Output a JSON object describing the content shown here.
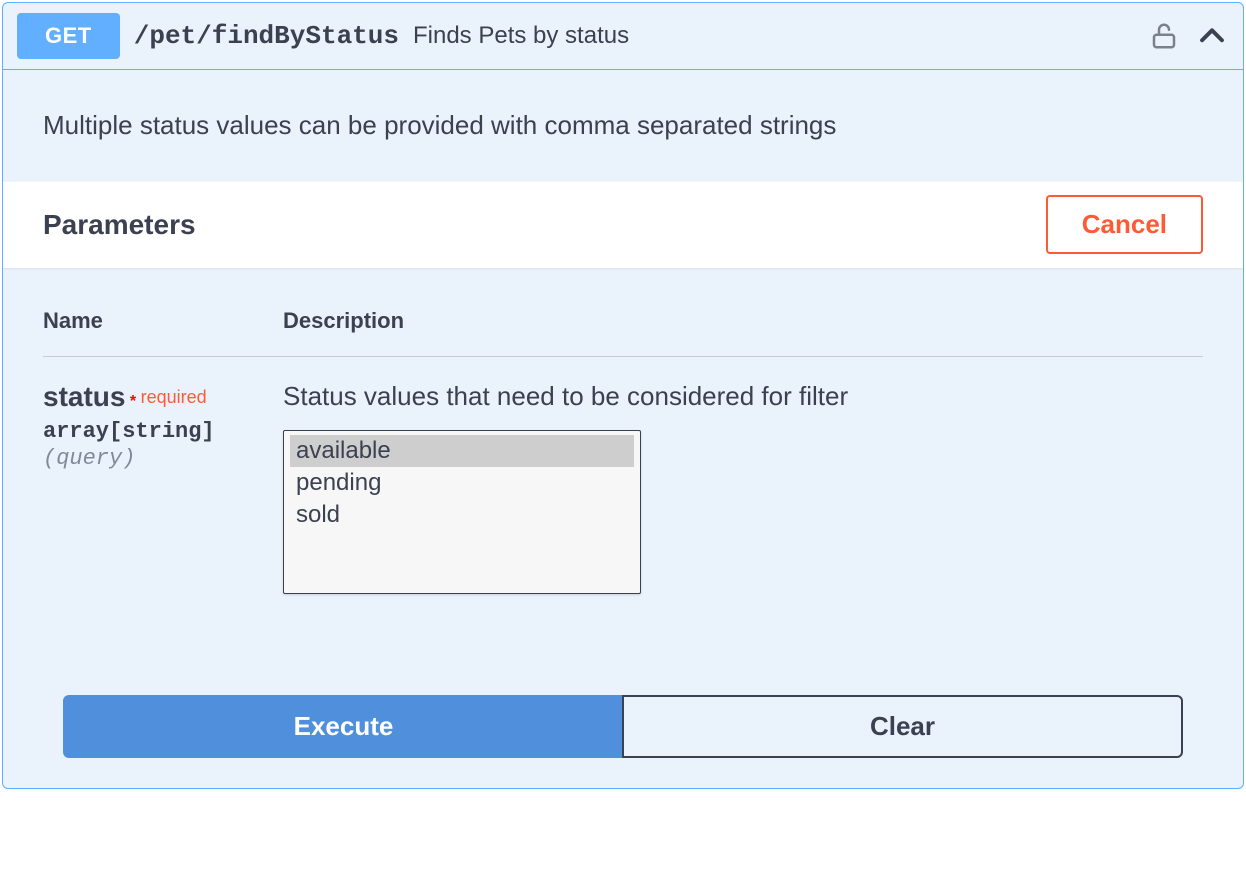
{
  "endpoint": {
    "method": "GET",
    "path": "/pet/findByStatus",
    "summary": "Finds Pets by status",
    "description": "Multiple status values can be provided with comma separated strings"
  },
  "parameters": {
    "title": "Parameters",
    "cancel_label": "Cancel",
    "columns": {
      "name": "Name",
      "description": "Description"
    },
    "items": [
      {
        "name": "status",
        "required_marker": "*",
        "required_label": "required",
        "type": "array[string]",
        "in": "query",
        "description": "Status values that need to be considered for filter",
        "options": [
          "available",
          "pending",
          "sold"
        ],
        "selected": [
          "available"
        ]
      }
    ]
  },
  "actions": {
    "execute_label": "Execute",
    "clear_label": "Clear"
  }
}
